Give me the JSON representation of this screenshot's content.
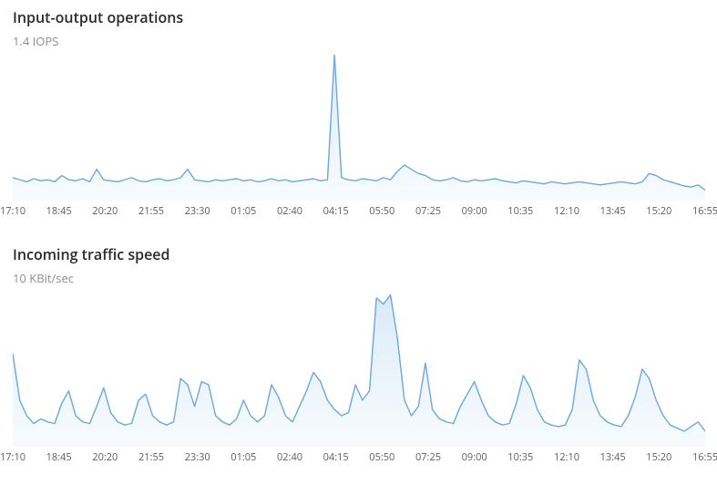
{
  "charts": [
    {
      "title": "Input-output operations",
      "subtitle": "1.4 IOPS",
      "height": 160,
      "ymax": 1.4
    },
    {
      "title": "Incoming traffic speed",
      "subtitle": "10 KBit/sec",
      "height": 170,
      "ymax": 10
    }
  ],
  "x_ticks": [
    "17:10",
    "18:45",
    "20:20",
    "21:55",
    "23:30",
    "01:05",
    "02:40",
    "04:15",
    "05:50",
    "07:25",
    "09:00",
    "10:35",
    "12:10",
    "13:45",
    "15:20",
    "16:55"
  ],
  "colors": {
    "stroke": "#6aa8de",
    "fill_top": "#d6e8f7",
    "fill_bottom": "#eef6fc"
  },
  "chart_data": [
    {
      "type": "area",
      "title": "Input-output operations",
      "ylabel": "IOPS",
      "ylim": [
        0,
        1.4
      ],
      "x_ticks": [
        "17:10",
        "18:45",
        "20:20",
        "21:55",
        "23:30",
        "01:05",
        "02:40",
        "04:15",
        "05:50",
        "07:25",
        "09:00",
        "10:35",
        "12:10",
        "13:45",
        "15:20",
        "16:55"
      ],
      "values": [
        0.22,
        0.2,
        0.18,
        0.21,
        0.19,
        0.2,
        0.18,
        0.24,
        0.2,
        0.19,
        0.21,
        0.18,
        0.3,
        0.2,
        0.19,
        0.18,
        0.2,
        0.22,
        0.19,
        0.18,
        0.2,
        0.21,
        0.19,
        0.2,
        0.22,
        0.3,
        0.2,
        0.19,
        0.18,
        0.2,
        0.19,
        0.2,
        0.21,
        0.19,
        0.2,
        0.18,
        0.19,
        0.21,
        0.19,
        0.2,
        0.18,
        0.19,
        0.2,
        0.21,
        0.19,
        0.2,
        1.4,
        0.22,
        0.2,
        0.19,
        0.21,
        0.2,
        0.19,
        0.22,
        0.2,
        0.28,
        0.34,
        0.3,
        0.26,
        0.24,
        0.2,
        0.19,
        0.2,
        0.22,
        0.19,
        0.18,
        0.2,
        0.19,
        0.2,
        0.21,
        0.19,
        0.18,
        0.17,
        0.19,
        0.18,
        0.17,
        0.16,
        0.18,
        0.17,
        0.16,
        0.17,
        0.18,
        0.17,
        0.16,
        0.15,
        0.16,
        0.17,
        0.18,
        0.17,
        0.16,
        0.18,
        0.26,
        0.24,
        0.2,
        0.18,
        0.16,
        0.14,
        0.13,
        0.15,
        0.1
      ]
    },
    {
      "type": "area",
      "title": "Incoming traffic speed",
      "ylabel": "KBit/sec",
      "ylim": [
        0,
        10
      ],
      "x_ticks": [
        "17:10",
        "18:45",
        "20:20",
        "21:55",
        "23:30",
        "01:05",
        "02:40",
        "04:15",
        "05:50",
        "07:25",
        "09:00",
        "10:35",
        "12:10",
        "13:45",
        "15:20",
        "16:55"
      ],
      "values": [
        6.0,
        3.0,
        2.0,
        1.5,
        1.8,
        1.6,
        1.5,
        2.8,
        3.6,
        2.0,
        1.6,
        1.5,
        2.6,
        3.8,
        2.2,
        1.6,
        1.4,
        1.5,
        3.0,
        3.4,
        2.0,
        1.6,
        1.4,
        1.6,
        4.4,
        4.0,
        2.6,
        4.2,
        4.0,
        2.0,
        1.6,
        1.4,
        1.8,
        3.0,
        2.0,
        1.6,
        2.0,
        4.0,
        3.2,
        2.0,
        1.6,
        2.6,
        3.6,
        4.8,
        4.2,
        3.0,
        2.4,
        2.0,
        2.2,
        4.0,
        3.0,
        3.6,
        9.6,
        9.2,
        9.8,
        7.0,
        3.0,
        2.0,
        2.6,
        5.4,
        2.4,
        1.8,
        1.6,
        1.5,
        2.6,
        3.4,
        4.2,
        3.0,
        2.0,
        1.6,
        1.4,
        1.5,
        2.8,
        4.6,
        3.8,
        2.4,
        1.6,
        1.4,
        1.3,
        1.4,
        2.4,
        5.6,
        5.0,
        3.0,
        2.0,
        1.6,
        1.4,
        1.3,
        2.0,
        3.2,
        5.0,
        4.4,
        3.0,
        2.0,
        1.4,
        1.2,
        1.0,
        1.3,
        1.6,
        1.0
      ]
    }
  ]
}
